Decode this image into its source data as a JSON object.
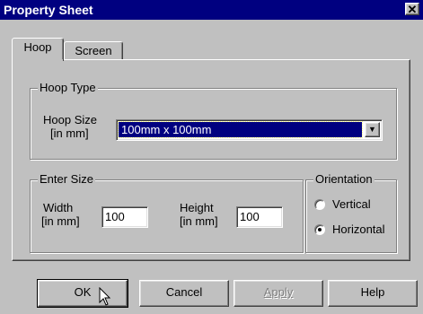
{
  "window": {
    "title": "Property Sheet",
    "close_glyph": "✕"
  },
  "tabs": [
    {
      "label": "Hoop",
      "active": true
    },
    {
      "label": "Screen",
      "active": false
    }
  ],
  "hoop_type": {
    "group_label": "Hoop Type",
    "hoop_size_label_line1": "Hoop Size",
    "hoop_size_label_line2": "[in mm]",
    "selected_value": "100mm x 100mm",
    "arrow_icon": "chevron-down-icon"
  },
  "enter_size": {
    "group_label": "Enter Size",
    "width_label_line1": "Width",
    "width_label_line2": "[in mm]",
    "width_value": "100",
    "height_label_line1": "Height",
    "height_label_line2": "[in mm]",
    "height_value": "100"
  },
  "orientation": {
    "group_label": "Orientation",
    "options": [
      {
        "label": "Vertical",
        "selected": false
      },
      {
        "label": "Horizontal",
        "selected": true
      }
    ]
  },
  "buttons": {
    "ok": "OK",
    "cancel": "Cancel",
    "apply": "Apply",
    "help": "Help"
  },
  "colors": {
    "titlebar": "#000080",
    "face": "#c0c0c0",
    "selection": "#000080"
  }
}
